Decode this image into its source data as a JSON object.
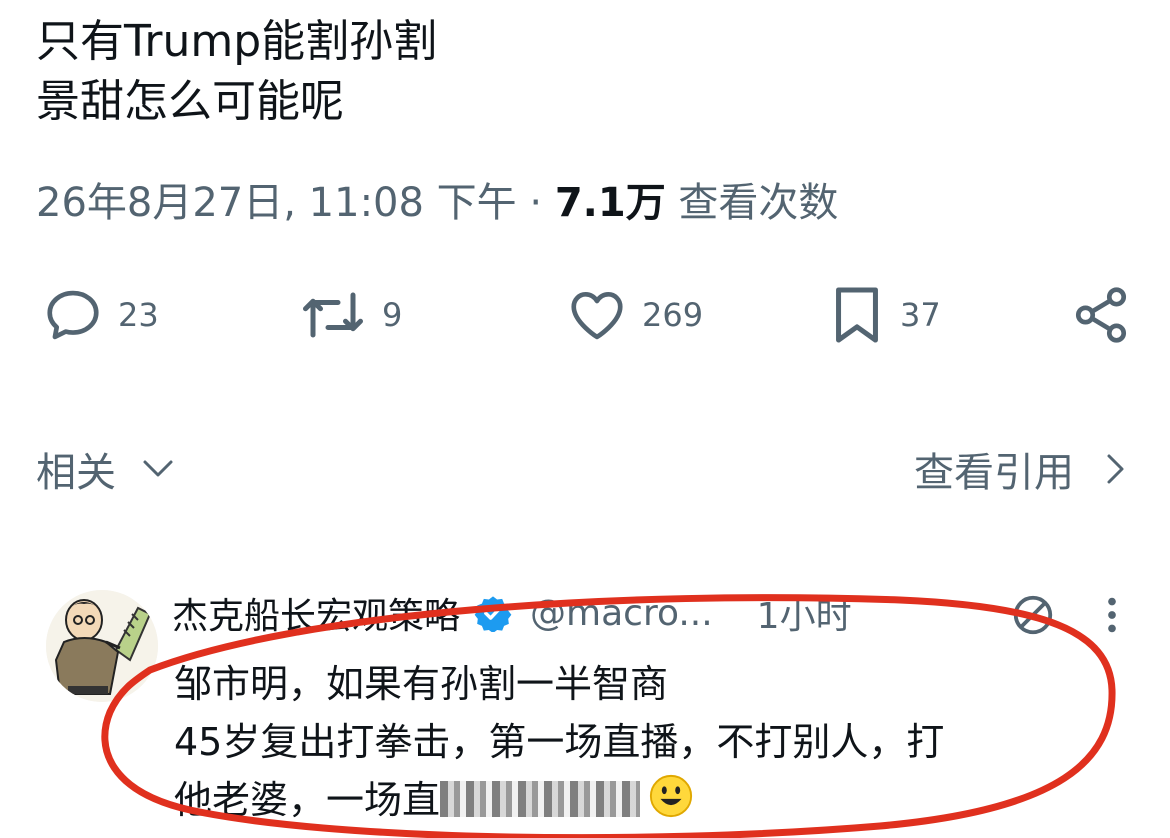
{
  "tweet": {
    "line1": "只有Trump能割孙割",
    "line2": "景甜怎么可能呢",
    "datetime": "26年8月27日, 11:08 下午",
    "views_count": "7.1万",
    "views_label": "查看次数"
  },
  "actions": {
    "replies": "23",
    "retweets": "9",
    "likes": "269",
    "bookmarks": "37"
  },
  "related": {
    "label": "相关",
    "quotes_link": "查看引用"
  },
  "reply": {
    "author": "杰克船长宏观策略",
    "handle": "@macro...",
    "time": "1小时",
    "line1": "邹市明，如果有孙割一半智商",
    "line2": "45岁复出打拳击，第一场直播，不打别人，打",
    "line3": "他老婆，一场直"
  },
  "colors": {
    "text": "#0f1419",
    "muted": "#536471",
    "verified": "#1d9bf0",
    "circle": "#e0301e"
  },
  "icons": [
    "reply-icon",
    "retweet-icon",
    "heart-icon",
    "bookmark-icon",
    "share-icon",
    "chevron-down-icon",
    "chevron-right-icon",
    "verified-icon",
    "mute-icon",
    "more-icon",
    "smile-emoji-icon"
  ]
}
